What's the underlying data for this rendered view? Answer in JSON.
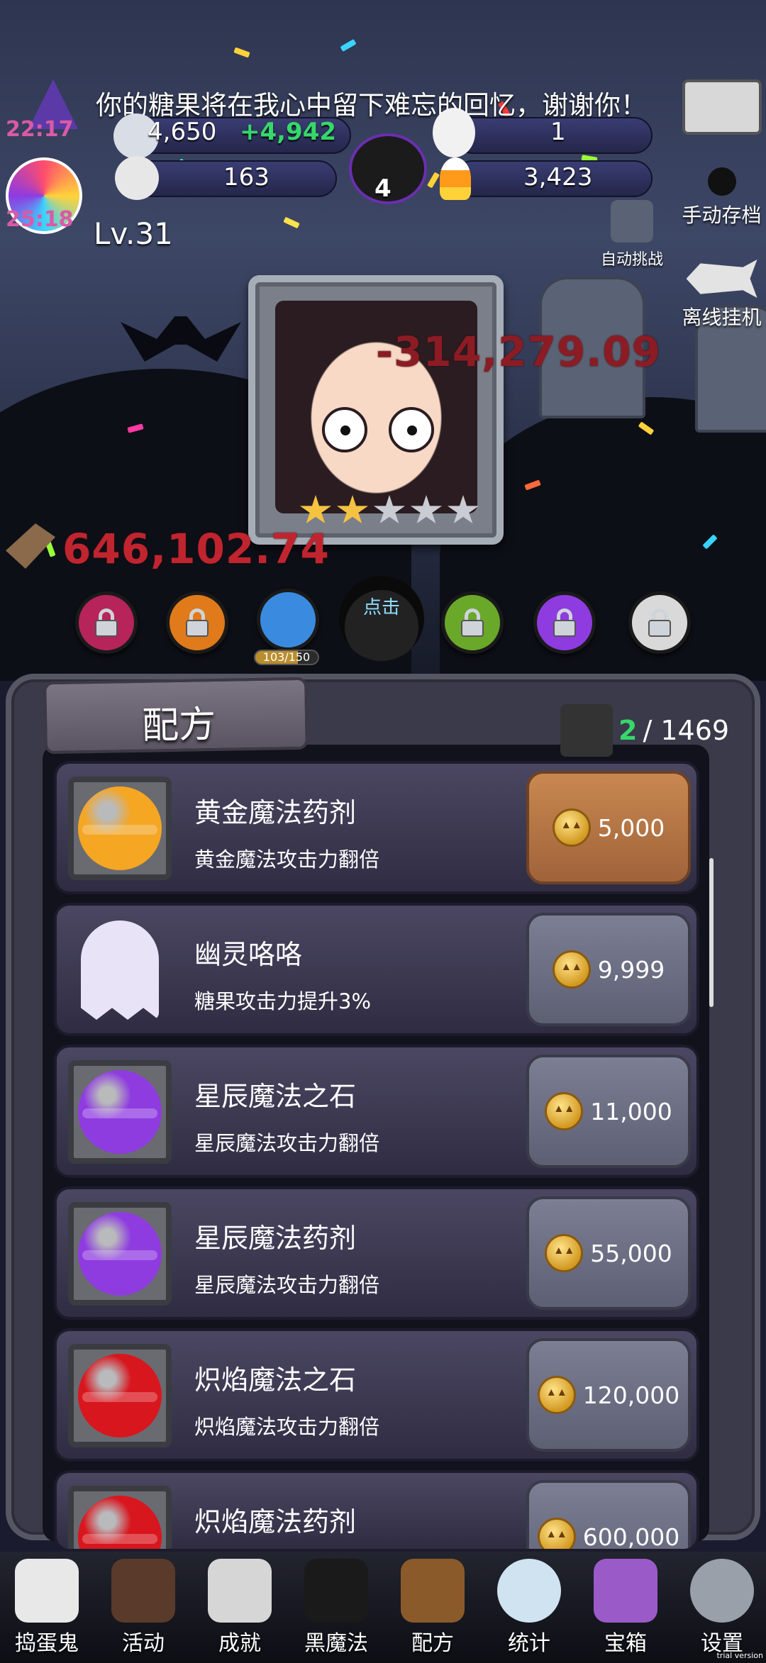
{
  "header": {
    "notice": "你的糖果将在我心中留下难忘的回忆，谢谢你！",
    "candy_total": "4,650",
    "candy_gain": "+4,942",
    "skull_count": "163",
    "cauldron_count": "4",
    "resource_right_top": "1",
    "candy_corn_count": "3,423",
    "timer_top": "22:17",
    "timer_bottom": "25:18",
    "level": "Lv.31",
    "auto_challenge_label": "自动挑战",
    "manual_save_label": "手动存档",
    "offline_idle_label": "离线挂机"
  },
  "battle": {
    "damage_main": "-314,279.09",
    "damage_axe": "646,102.74",
    "stars_filled": 2,
    "stars_total": 5,
    "orb_progress_text": "103/150",
    "orb_progress_ratio": 0.687,
    "demon_label": "点击"
  },
  "recipes": {
    "title": "配方",
    "count_current": "2",
    "count_total": "/ 1469",
    "items": [
      {
        "name": "黄金魔法药剂",
        "desc": "黄金魔法攻击力翻倍",
        "price": "5,000",
        "active": true,
        "color": "#f5a623"
      },
      {
        "name": "幽灵咯咯",
        "desc": "糖果攻击力提升3%",
        "price": "9,999",
        "active": false,
        "color": "#e9e3f7"
      },
      {
        "name": "星辰魔法之石",
        "desc": "星辰魔法攻击力翻倍",
        "price": "11,000",
        "active": false,
        "color": "#8e3be0"
      },
      {
        "name": "星辰魔法药剂",
        "desc": "星辰魔法攻击力翻倍",
        "price": "55,000",
        "active": false,
        "color": "#8e3be0"
      },
      {
        "name": "炽焰魔法之石",
        "desc": "炽焰魔法攻击力翻倍",
        "price": "120,000",
        "active": false,
        "color": "#d8161e"
      },
      {
        "name": "炽焰魔法药剂",
        "desc": "",
        "price": "600,000",
        "active": false,
        "color": "#d8161e"
      }
    ]
  },
  "nav": {
    "items": [
      {
        "label": "捣蛋鬼",
        "icon": "ghost-icon"
      },
      {
        "label": "活动",
        "icon": "eyeball-cake-icon"
      },
      {
        "label": "成就",
        "icon": "skull-trophy-icon"
      },
      {
        "label": "黑魔法",
        "icon": "demon-icon"
      },
      {
        "label": "配方",
        "icon": "spellbook-icon"
      },
      {
        "label": "统计",
        "icon": "crystal-ball-icon"
      },
      {
        "label": "宝箱",
        "icon": "treasure-chest-icon"
      },
      {
        "label": "设置",
        "icon": "gear-icon"
      }
    ]
  },
  "footer": {
    "trial": "trial version"
  }
}
